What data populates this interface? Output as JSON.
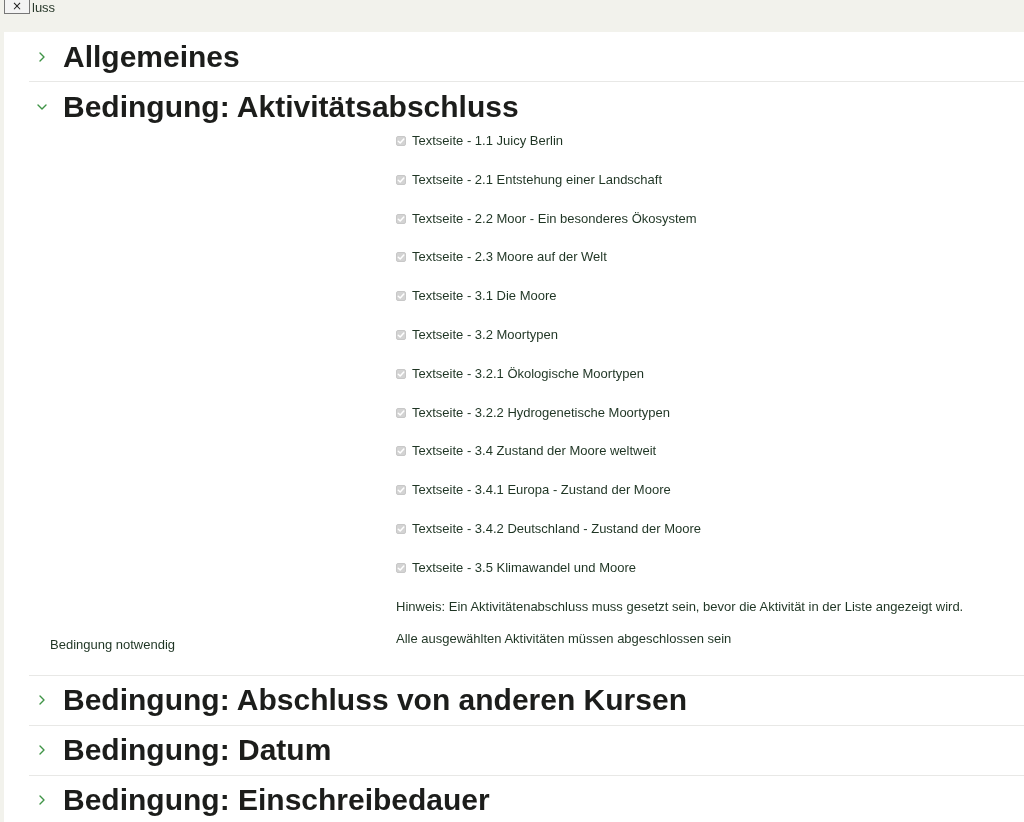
{
  "top_bar": {
    "close_button": "×",
    "title_fragment": "luss"
  },
  "sections": [
    {
      "title": "Allgemeines",
      "expanded": false
    },
    {
      "title": "Bedingung: Aktivitätsabschluss",
      "expanded": true,
      "activities": [
        {
          "label": "Textseite - 1.1 Juicy Berlin",
          "checked": true,
          "disabled": true
        },
        {
          "label": "Textseite - 2.1 Entstehung einer Landschaft",
          "checked": true,
          "disabled": true
        },
        {
          "label": "Textseite - 2.2 Moor - Ein besonderes Ökosystem",
          "checked": true,
          "disabled": true
        },
        {
          "label": "Textseite - 2.3 Moore auf der Welt",
          "checked": true,
          "disabled": true
        },
        {
          "label": "Textseite - 3.1 Die Moore",
          "checked": true,
          "disabled": true
        },
        {
          "label": "Textseite - 3.2 Moortypen",
          "checked": true,
          "disabled": true
        },
        {
          "label": "Textseite - 3.2.1 Ökologische Moortypen",
          "checked": true,
          "disabled": true
        },
        {
          "label": "Textseite - 3.2.2 Hydrogenetische Moortypen",
          "checked": true,
          "disabled": true
        },
        {
          "label": "Textseite - 3.4 Zustand der Moore weltweit",
          "checked": true,
          "disabled": true
        },
        {
          "label": "Textseite - 3.4.1 Europa - Zustand der Moore",
          "checked": true,
          "disabled": true
        },
        {
          "label": "Textseite - 3.4.2 Deutschland - Zustand der Moore",
          "checked": true,
          "disabled": true
        },
        {
          "label": "Textseite - 3.5 Klimawandel und Moore",
          "checked": true,
          "disabled": true
        }
      ],
      "hint": "Hinweis: Ein Aktivitätenabschluss muss gesetzt sein, bevor die Aktivität in der Liste angezeigt wird.",
      "requirement": {
        "label": "Bedingung notwendig",
        "value": "Alle ausgewählten Aktivitäten müssen abgeschlossen sein"
      }
    },
    {
      "title": "Bedingung: Abschluss von anderen Kursen",
      "expanded": false
    },
    {
      "title": "Bedingung: Datum",
      "expanded": false
    },
    {
      "title": "Bedingung: Einschreibedauer",
      "expanded": false
    }
  ]
}
